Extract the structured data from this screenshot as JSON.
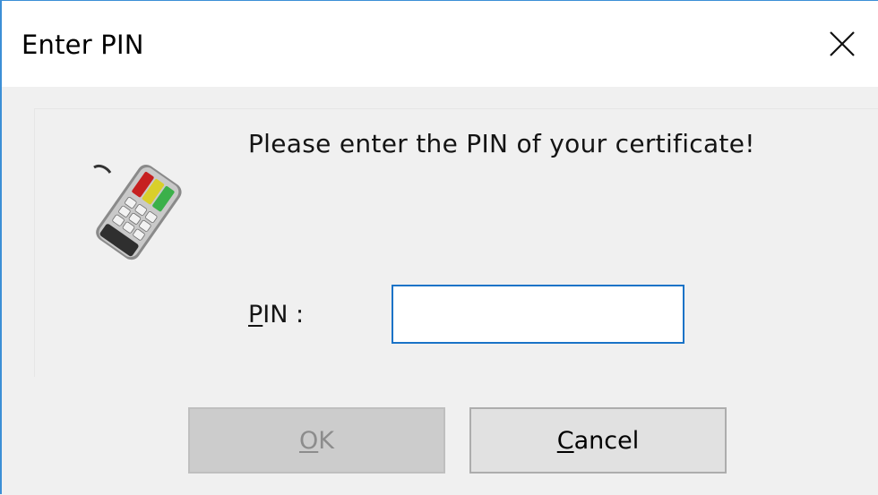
{
  "window": {
    "title": "Enter PIN"
  },
  "dialog": {
    "message": "Please enter the PIN of your certificate!",
    "pin_label_mnemonic": "P",
    "pin_label_rest": "IN :",
    "pin_value": ""
  },
  "buttons": {
    "ok_mnemonic": "O",
    "ok_rest": "K",
    "ok_enabled": false,
    "cancel_mnemonic": "C",
    "cancel_rest": "ancel"
  },
  "icons": {
    "close": "close-icon",
    "device": "pin-pad-icon"
  },
  "colors": {
    "accent": "#3c8fd6",
    "input_focus": "#1a73c7"
  }
}
